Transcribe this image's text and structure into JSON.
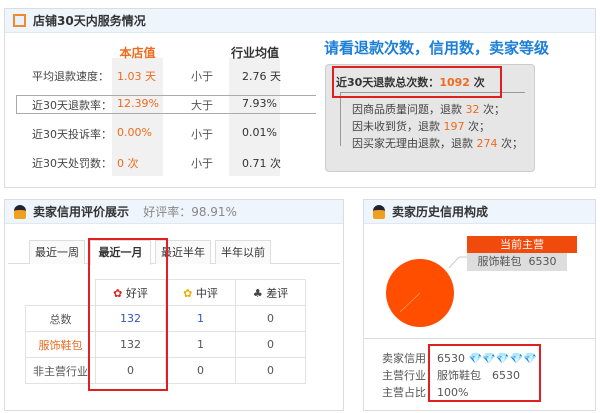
{
  "service": {
    "title": "店铺30天内服务情况",
    "col_store": "本店值",
    "col_industry": "行业均值",
    "rows": [
      {
        "label": "平均退款速度：",
        "store": "1.03 天",
        "cmp": "小于",
        "industry": "2.76 天"
      },
      {
        "label": "近30天退款率：",
        "store": "12.39%",
        "cmp": "大于",
        "industry": "7.93%"
      },
      {
        "label": "近30天投诉率：",
        "store": "0.00%",
        "cmp": "小于",
        "industry": "0.01%"
      },
      {
        "label": "近30天处罚数：",
        "store": "0 次",
        "cmp": "小于",
        "industry": "0.71 次"
      }
    ]
  },
  "annotation": "请看退款次数，信用数，卖家等级",
  "refund": {
    "total_label": "近30天退款总次数：",
    "total": "1092",
    "unit": "次",
    "items": [
      {
        "pre": "因商品质量问题，退款",
        "n": "32",
        "post": "次；"
      },
      {
        "pre": "因未收到货，退款",
        "n": "197",
        "post": "次；"
      },
      {
        "pre": "因买家无理由退款，退款",
        "n": "274",
        "post": "次；"
      }
    ]
  },
  "rating": {
    "title": "卖家信用评价展示",
    "rate_label": "好评率：98.91%",
    "tabs": [
      "最近一周",
      "最近一月",
      "最近半年",
      "半年以前"
    ],
    "headers": [
      "好评",
      "中评",
      "差评"
    ],
    "rows": [
      {
        "label": "总数",
        "v": [
          "132",
          "1",
          "0"
        ]
      },
      {
        "label": "服饰鞋包",
        "v": [
          "132",
          "1",
          "0"
        ]
      },
      {
        "label": "非主营行业",
        "v": [
          "0",
          "0",
          "0"
        ]
      }
    ]
  },
  "history": {
    "title": "卖家历史信用构成",
    "banner": "当前主营",
    "category": "服饰鞋包",
    "category_value": "6530",
    "credit_label": "卖家信用：",
    "credit": "6530",
    "industry_label": "主营行业：",
    "industry": "服饰鞋包　6530",
    "share_label": "主营占比：",
    "share": "100%",
    "pie_share": 100,
    "pie_color": "#ff4e00"
  }
}
